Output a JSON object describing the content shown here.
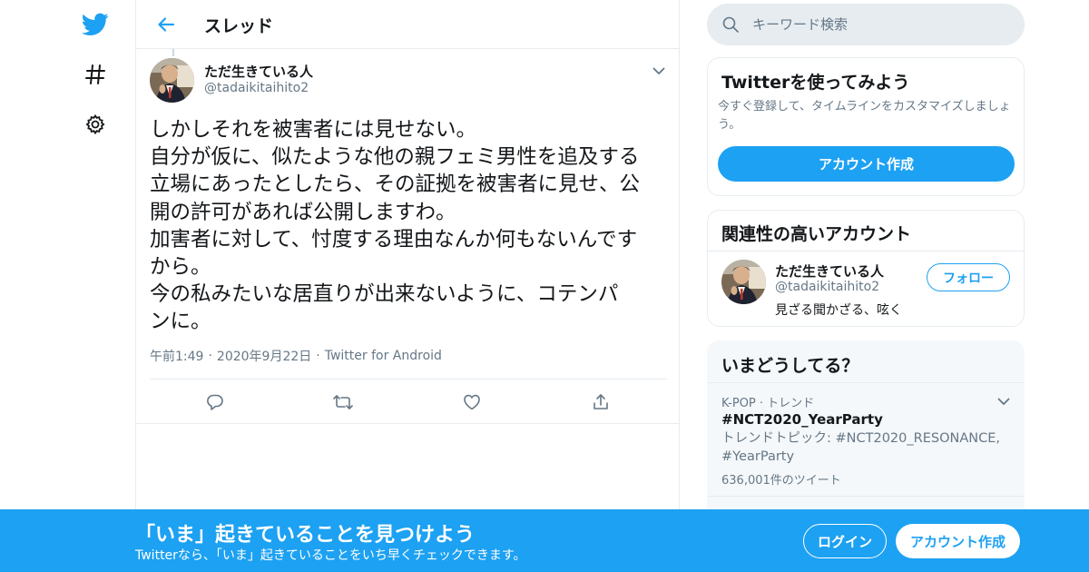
{
  "colors": {
    "brand": "#1da1f2",
    "text": "#14171a",
    "secondary_text": "#657786",
    "divider": "#e6ecf0"
  },
  "nav": {
    "icons": [
      "twitter-bird-icon",
      "hashtag-icon",
      "settings-gear-icon"
    ]
  },
  "header": {
    "title": "スレッド"
  },
  "tweet": {
    "author_name": "ただ生きている人",
    "author_handle": "@tadaikitaihito2",
    "text_lines": [
      "しかしそれを被害者には見せない。",
      "自分が仮に、似たような他の親フェミ男性を追及する",
      "立場にあったとしたら、その証拠を被害者に見せ、公",
      "開の許可があれば公開しますわ。",
      "加害者に対して、忖度する理由なんか何もないんです",
      "から。",
      "今の私みたいな居直りが出来ないように、コテンパ",
      "ンに。"
    ],
    "time": "午前1:49",
    "date": "2020年9月22日",
    "source": "Twitter for Android",
    "separator": "·"
  },
  "search": {
    "placeholder": "キーワード検索"
  },
  "signup_card": {
    "title": "Twitterを使ってみよう",
    "description": "今すぐ登録して、タイムラインをカスタマイズしましょう。",
    "button_label": "アカウント作成"
  },
  "related": {
    "title": "関連性の高いアカウント",
    "account": {
      "name": "ただ生きている人",
      "handle": "@tadaikitaihito2",
      "bio": "見ざる聞かざる、呟く",
      "follow_label": "フォロー"
    }
  },
  "trends": {
    "title": "いまどうしてる？",
    "items": [
      {
        "context": "K-POP · トレンド",
        "name": "#NCT2020_YearParty",
        "topic": "トレンドトピック: #NCT2020_RESONANCE, #YearParty",
        "count": "636,001件のツイート"
      }
    ]
  },
  "banner": {
    "title": "「いま」起きていることを見つけよう",
    "subtitle": "Twitterなら、「いま」起きていることをいち早くチェックできます。",
    "login_label": "ログイン",
    "signup_label": "アカウント作成"
  }
}
